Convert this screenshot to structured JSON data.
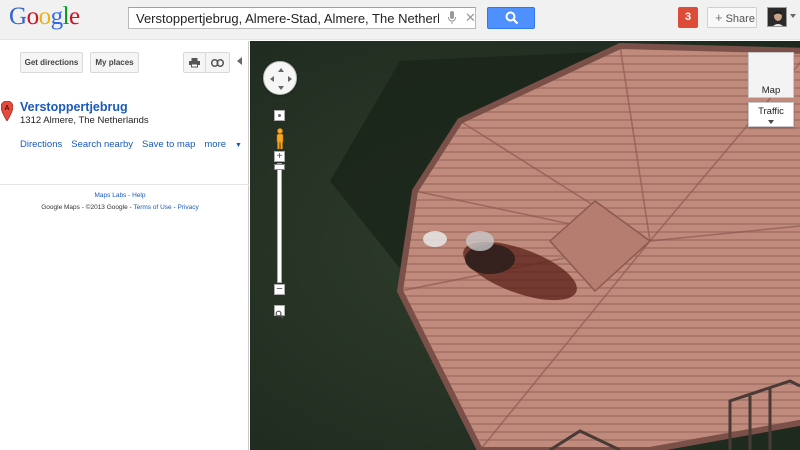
{
  "header": {
    "logo_text": "Google",
    "search_value": "Verstoppertjebrug, Almere-Stad, Almere, The Netherlands",
    "notification_count": "3",
    "share_label": "Share"
  },
  "sidebar": {
    "buttons": {
      "directions": "Get directions",
      "my_places": "My places"
    },
    "place": {
      "marker_letter": "A",
      "title": "Verstoppertjebrug",
      "address": "1312 Almere, The Netherlands"
    },
    "actions": {
      "directions": "Directions",
      "search_nearby": "Search nearby",
      "save_to_map": "Save to map",
      "more": "more"
    },
    "footer": {
      "maps_labs": "Maps Labs",
      "sep1": " - ",
      "help": "Help",
      "copyright": "Google Maps - ©2013 Google - ",
      "terms": "Terms of Use",
      "sep2": " - ",
      "privacy": "Privacy"
    }
  },
  "map": {
    "type_button": "Map",
    "traffic_button": "Traffic",
    "zoom_plus": "+",
    "zoom_minus": "−"
  },
  "colors": {
    "accent_blue": "#4d90fe",
    "link_blue": "#1a5ab8",
    "notification_red": "#dd4b39",
    "water_green": "#263425"
  }
}
